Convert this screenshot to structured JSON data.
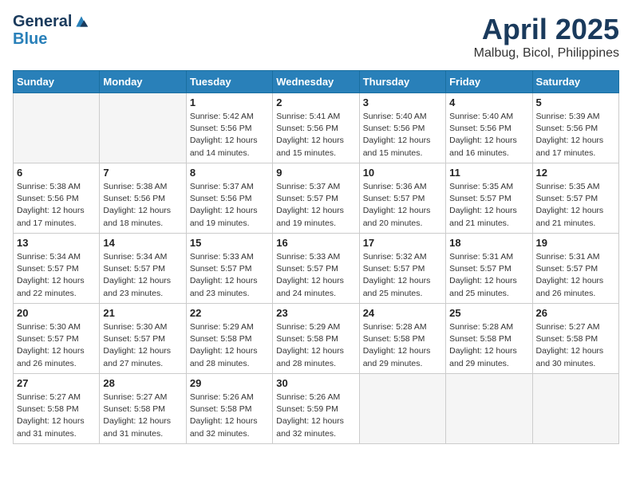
{
  "header": {
    "logo_line1": "General",
    "logo_line2": "Blue",
    "month_title": "April 2025",
    "location": "Malbug, Bicol, Philippines"
  },
  "days_of_week": [
    "Sunday",
    "Monday",
    "Tuesday",
    "Wednesday",
    "Thursday",
    "Friday",
    "Saturday"
  ],
  "weeks": [
    [
      {
        "day": "",
        "empty": true
      },
      {
        "day": "",
        "empty": true
      },
      {
        "day": "1",
        "sunrise": "Sunrise: 5:42 AM",
        "sunset": "Sunset: 5:56 PM",
        "daylight": "Daylight: 12 hours and 14 minutes."
      },
      {
        "day": "2",
        "sunrise": "Sunrise: 5:41 AM",
        "sunset": "Sunset: 5:56 PM",
        "daylight": "Daylight: 12 hours and 15 minutes."
      },
      {
        "day": "3",
        "sunrise": "Sunrise: 5:40 AM",
        "sunset": "Sunset: 5:56 PM",
        "daylight": "Daylight: 12 hours and 15 minutes."
      },
      {
        "day": "4",
        "sunrise": "Sunrise: 5:40 AM",
        "sunset": "Sunset: 5:56 PM",
        "daylight": "Daylight: 12 hours and 16 minutes."
      },
      {
        "day": "5",
        "sunrise": "Sunrise: 5:39 AM",
        "sunset": "Sunset: 5:56 PM",
        "daylight": "Daylight: 12 hours and 17 minutes."
      }
    ],
    [
      {
        "day": "6",
        "sunrise": "Sunrise: 5:38 AM",
        "sunset": "Sunset: 5:56 PM",
        "daylight": "Daylight: 12 hours and 17 minutes."
      },
      {
        "day": "7",
        "sunrise": "Sunrise: 5:38 AM",
        "sunset": "Sunset: 5:56 PM",
        "daylight": "Daylight: 12 hours and 18 minutes."
      },
      {
        "day": "8",
        "sunrise": "Sunrise: 5:37 AM",
        "sunset": "Sunset: 5:56 PM",
        "daylight": "Daylight: 12 hours and 19 minutes."
      },
      {
        "day": "9",
        "sunrise": "Sunrise: 5:37 AM",
        "sunset": "Sunset: 5:57 PM",
        "daylight": "Daylight: 12 hours and 19 minutes."
      },
      {
        "day": "10",
        "sunrise": "Sunrise: 5:36 AM",
        "sunset": "Sunset: 5:57 PM",
        "daylight": "Daylight: 12 hours and 20 minutes."
      },
      {
        "day": "11",
        "sunrise": "Sunrise: 5:35 AM",
        "sunset": "Sunset: 5:57 PM",
        "daylight": "Daylight: 12 hours and 21 minutes."
      },
      {
        "day": "12",
        "sunrise": "Sunrise: 5:35 AM",
        "sunset": "Sunset: 5:57 PM",
        "daylight": "Daylight: 12 hours and 21 minutes."
      }
    ],
    [
      {
        "day": "13",
        "sunrise": "Sunrise: 5:34 AM",
        "sunset": "Sunset: 5:57 PM",
        "daylight": "Daylight: 12 hours and 22 minutes."
      },
      {
        "day": "14",
        "sunrise": "Sunrise: 5:34 AM",
        "sunset": "Sunset: 5:57 PM",
        "daylight": "Daylight: 12 hours and 23 minutes."
      },
      {
        "day": "15",
        "sunrise": "Sunrise: 5:33 AM",
        "sunset": "Sunset: 5:57 PM",
        "daylight": "Daylight: 12 hours and 23 minutes."
      },
      {
        "day": "16",
        "sunrise": "Sunrise: 5:33 AM",
        "sunset": "Sunset: 5:57 PM",
        "daylight": "Daylight: 12 hours and 24 minutes."
      },
      {
        "day": "17",
        "sunrise": "Sunrise: 5:32 AM",
        "sunset": "Sunset: 5:57 PM",
        "daylight": "Daylight: 12 hours and 25 minutes."
      },
      {
        "day": "18",
        "sunrise": "Sunrise: 5:31 AM",
        "sunset": "Sunset: 5:57 PM",
        "daylight": "Daylight: 12 hours and 25 minutes."
      },
      {
        "day": "19",
        "sunrise": "Sunrise: 5:31 AM",
        "sunset": "Sunset: 5:57 PM",
        "daylight": "Daylight: 12 hours and 26 minutes."
      }
    ],
    [
      {
        "day": "20",
        "sunrise": "Sunrise: 5:30 AM",
        "sunset": "Sunset: 5:57 PM",
        "daylight": "Daylight: 12 hours and 26 minutes."
      },
      {
        "day": "21",
        "sunrise": "Sunrise: 5:30 AM",
        "sunset": "Sunset: 5:57 PM",
        "daylight": "Daylight: 12 hours and 27 minutes."
      },
      {
        "day": "22",
        "sunrise": "Sunrise: 5:29 AM",
        "sunset": "Sunset: 5:58 PM",
        "daylight": "Daylight: 12 hours and 28 minutes."
      },
      {
        "day": "23",
        "sunrise": "Sunrise: 5:29 AM",
        "sunset": "Sunset: 5:58 PM",
        "daylight": "Daylight: 12 hours and 28 minutes."
      },
      {
        "day": "24",
        "sunrise": "Sunrise: 5:28 AM",
        "sunset": "Sunset: 5:58 PM",
        "daylight": "Daylight: 12 hours and 29 minutes."
      },
      {
        "day": "25",
        "sunrise": "Sunrise: 5:28 AM",
        "sunset": "Sunset: 5:58 PM",
        "daylight": "Daylight: 12 hours and 29 minutes."
      },
      {
        "day": "26",
        "sunrise": "Sunrise: 5:27 AM",
        "sunset": "Sunset: 5:58 PM",
        "daylight": "Daylight: 12 hours and 30 minutes."
      }
    ],
    [
      {
        "day": "27",
        "sunrise": "Sunrise: 5:27 AM",
        "sunset": "Sunset: 5:58 PM",
        "daylight": "Daylight: 12 hours and 31 minutes."
      },
      {
        "day": "28",
        "sunrise": "Sunrise: 5:27 AM",
        "sunset": "Sunset: 5:58 PM",
        "daylight": "Daylight: 12 hours and 31 minutes."
      },
      {
        "day": "29",
        "sunrise": "Sunrise: 5:26 AM",
        "sunset": "Sunset: 5:58 PM",
        "daylight": "Daylight: 12 hours and 32 minutes."
      },
      {
        "day": "30",
        "sunrise": "Sunrise: 5:26 AM",
        "sunset": "Sunset: 5:59 PM",
        "daylight": "Daylight: 12 hours and 32 minutes."
      },
      {
        "day": "",
        "empty": true
      },
      {
        "day": "",
        "empty": true
      },
      {
        "day": "",
        "empty": true
      }
    ]
  ]
}
